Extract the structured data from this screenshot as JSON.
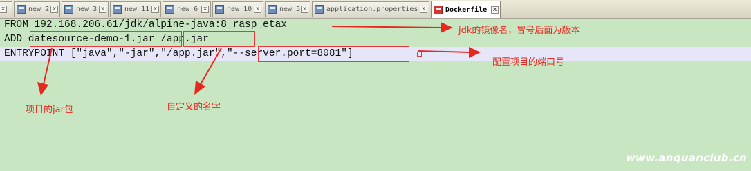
{
  "tabs": [
    {
      "label": "",
      "active": false
    },
    {
      "label": "new 2",
      "active": false
    },
    {
      "label": "new 3",
      "active": false
    },
    {
      "label": "new 11",
      "active": false
    },
    {
      "label": "new 6",
      "active": false
    },
    {
      "label": "new 10",
      "active": false
    },
    {
      "label": "new 5",
      "active": false
    },
    {
      "label": "application.properties",
      "active": false
    },
    {
      "label": "Dockerfile",
      "active": true
    }
  ],
  "close_glyph": "x",
  "editor": {
    "lines": [
      "FROM 192.168.206.61/jdk/alpine-java:8_rasp_etax",
      "ADD datesource-demo-1.jar /app.jar",
      "ENTRYPOINT [\"java\",\"-jar\",\"/app.jar\",\"--server.port=8081\"]"
    ]
  },
  "annotations": {
    "image_name": "jdk的镜像名，冒号后面为版本",
    "port": "配置项目的端口号",
    "jar_package": "项目的jar包",
    "custom_name": "自定义的名字"
  },
  "watermark": "www.anquanclub.cn",
  "colors": {
    "editor_bg": "#c8e6c2",
    "current_line": "#e6e6f8",
    "annotation_red": "#e8271f"
  }
}
